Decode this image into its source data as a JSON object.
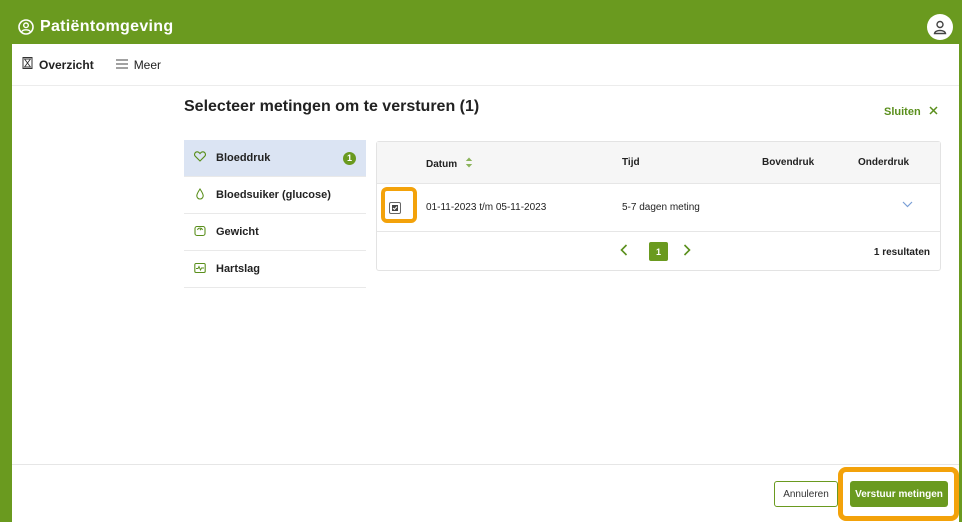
{
  "app": {
    "title": "Patiëntomgeving"
  },
  "nav": {
    "overview": "Overzicht",
    "more": "Meer"
  },
  "dialog": {
    "title": "Selecteer metingen om te versturen (1)",
    "close_label": "Sluiten"
  },
  "categories": [
    {
      "label": "Bloeddruk",
      "icon": "heart-icon",
      "badge": "1",
      "active": true
    },
    {
      "label": "Bloedsuiker (glucose)",
      "icon": "drop-icon"
    },
    {
      "label": "Gewicht",
      "icon": "scale-icon"
    },
    {
      "label": "Hartslag",
      "icon": "heartrate-icon"
    }
  ],
  "table": {
    "columns": [
      "Datum",
      "Tijd",
      "Bovendruk",
      "Onderdruk"
    ],
    "rows": [
      {
        "datum": "01-11-2023 t/m 05-11-2023",
        "tijd": "5-7 dagen meting",
        "bovendruk": "",
        "onderdruk": "",
        "checked": true
      }
    ],
    "pagination": {
      "current_page": "1",
      "results": "1 resultaten"
    }
  },
  "footer": {
    "cancel_label": "Annuleren",
    "submit_label": "Verstuur metingen"
  },
  "colors": {
    "brand": "#6a9a1f",
    "highlight": "#f3a20a",
    "active_bg": "#dbe4f3"
  }
}
